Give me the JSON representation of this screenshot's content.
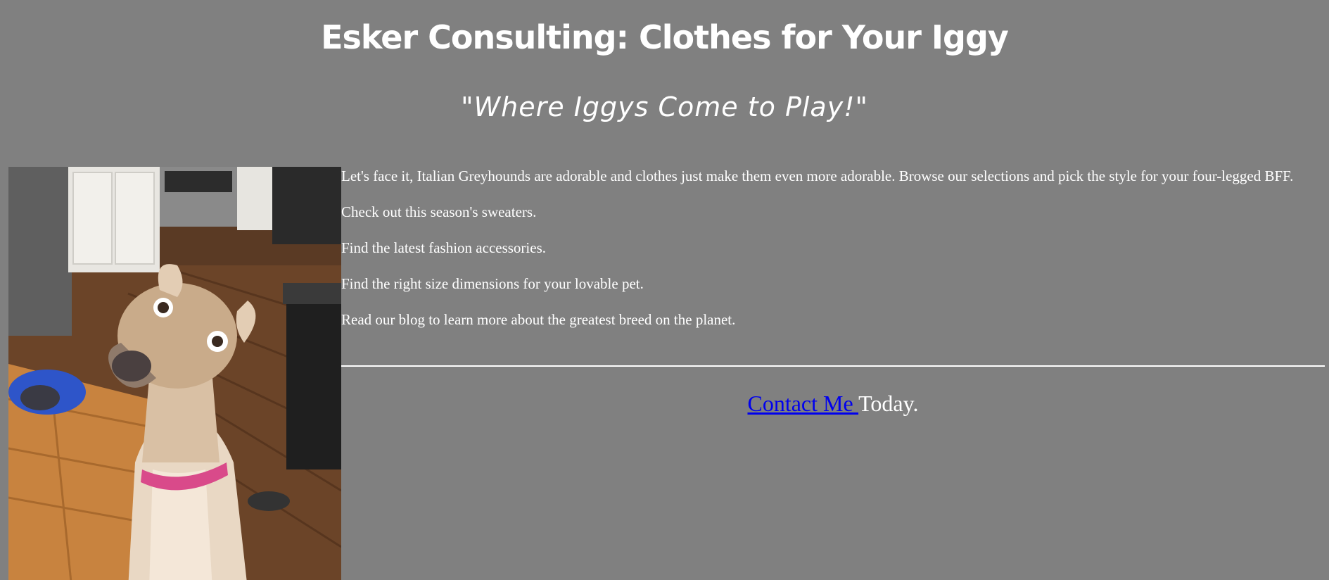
{
  "header": {
    "title": "Esker Consulting: Clothes for Your Iggy",
    "tagline": "\"Where Iggys Come to Play!\""
  },
  "main": {
    "paragraphs": [
      "Let's face it, Italian Greyhounds are adorable and clothes just make them even more adorable. Browse our selections and pick the style for your four-legged BFF.",
      "Check out this season's sweaters.",
      "Find the latest fashion accessories.",
      "Find the right size dimensions for your lovable pet.",
      "Read our blog to learn more about the greatest breed on the planet."
    ]
  },
  "contact": {
    "link_label": "Contact Me ",
    "suffix": "Today."
  },
  "colors": {
    "background": "#808080",
    "text": "#ffffff",
    "link": "#0000ee"
  }
}
